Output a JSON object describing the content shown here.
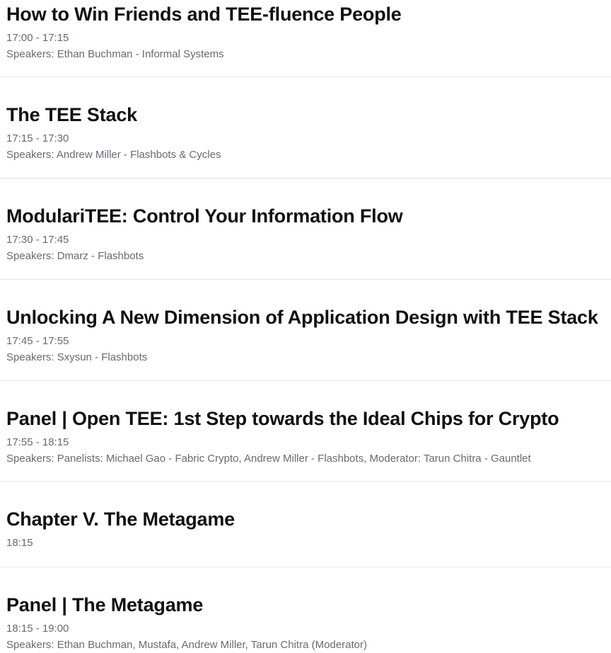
{
  "sessions": [
    {
      "title": "How to Win Friends and TEE-fluence People",
      "time": "17:00 - 17:15",
      "speakers": "Speakers: Ethan Buchman - Informal Systems"
    },
    {
      "title": "The TEE Stack",
      "time": "17:15 - 17:30",
      "speakers": "Speakers: Andrew Miller - Flashbots & Cycles"
    },
    {
      "title": "ModulariTEE: Control Your Information Flow",
      "time": "17:30 - 17:45",
      "speakers": "Speakers: Dmarz - Flashbots"
    },
    {
      "title": "Unlocking A New Dimension of Application Design with TEE Stack",
      "time": "17:45 - 17:55",
      "speakers": "Speakers: Sxysun - Flashbots"
    },
    {
      "title": "Panel | Open TEE: 1st Step towards the Ideal Chips for Crypto",
      "time": "17:55 - 18:15",
      "speakers": "Speakers: Panelists: Michael Gao - Fabric Crypto, Andrew Miller - Flashbots, Moderator: Tarun Chitra - Gauntlet"
    },
    {
      "title": "Chapter V. The Metagame",
      "time": "18:15",
      "speakers": ""
    },
    {
      "title": "Panel | The Metagame",
      "time": "18:15 - 19:00",
      "speakers": "Speakers: Ethan Buchman, Mustafa, Andrew Miller, Tarun Chitra (Moderator)"
    }
  ]
}
